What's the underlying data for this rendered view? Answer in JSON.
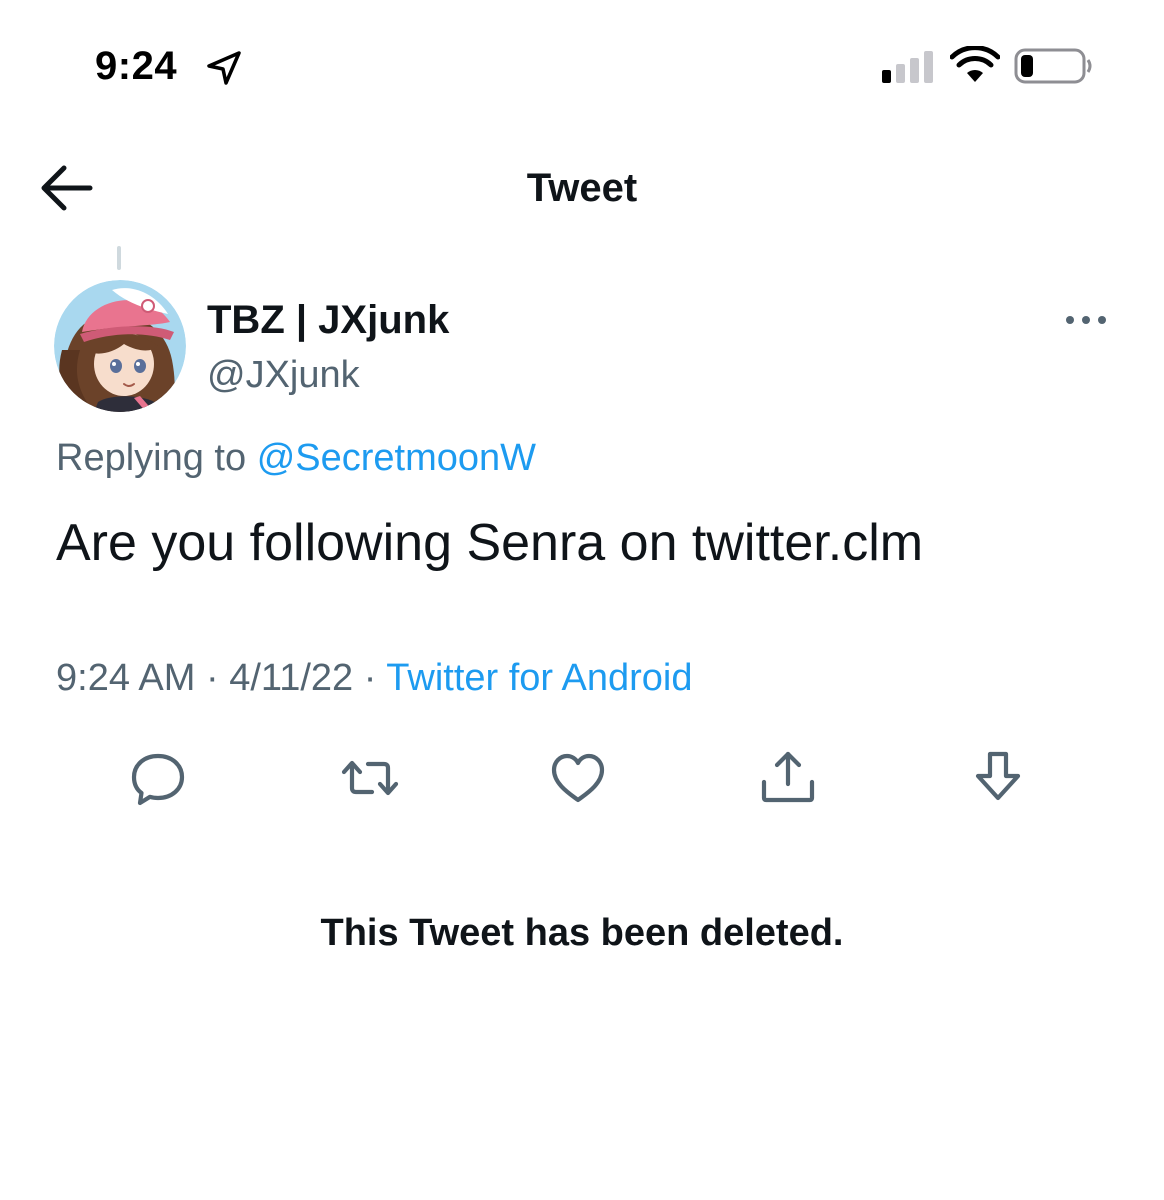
{
  "status_bar": {
    "time": "9:24",
    "icons": [
      "location-arrow-icon",
      "cellular-signal-icon",
      "wifi-icon",
      "battery-icon"
    ]
  },
  "header": {
    "title": "Tweet",
    "back_icon": "arrow-left-icon"
  },
  "tweet": {
    "display_name": "TBZ | JXjunk",
    "handle": "@JXjunk",
    "replying_prefix": "Replying to",
    "replying_to": "@SecretmoonW",
    "text": "Are you following Senra on twitter.clm",
    "time": "9:24 AM",
    "separator": "·",
    "date": "4/11/22",
    "source": "Twitter for Android",
    "more_icon": "ellipsis-icon",
    "actions": [
      "reply-icon",
      "retweet-icon",
      "like-icon",
      "share-icon",
      "download-icon"
    ]
  },
  "notice": {
    "deleted_text": "This Tweet has been deleted."
  },
  "colors": {
    "text": "#0f1419",
    "secondary": "#536471",
    "link": "#1d9bf0",
    "divider": "#cfd9de"
  }
}
